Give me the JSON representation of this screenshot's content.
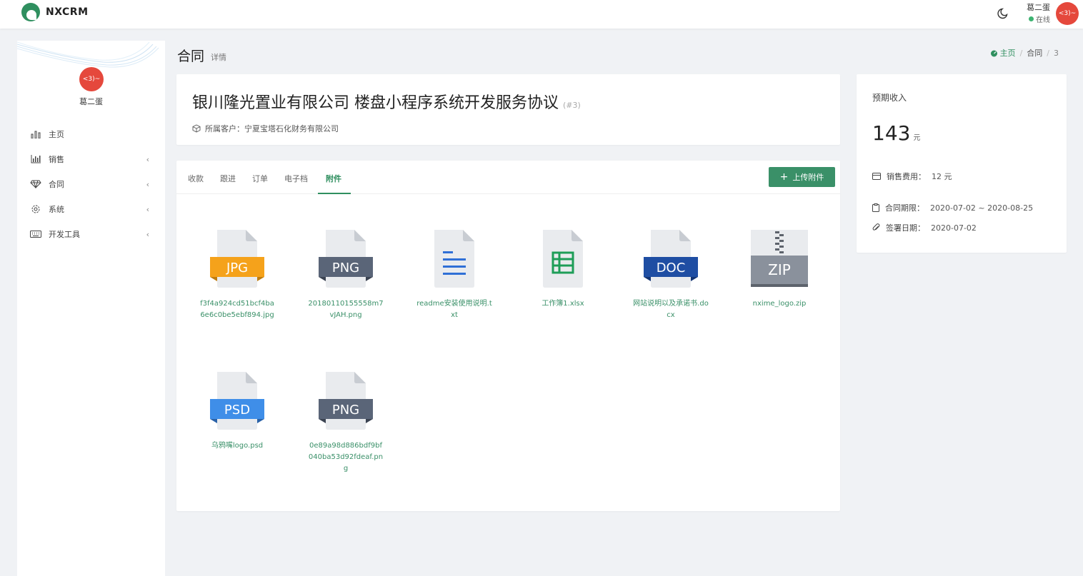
{
  "app": {
    "name": "NXCRM"
  },
  "topbar": {
    "user_name": "葛二蛋",
    "status": "在线",
    "avatar_text": "<3)~"
  },
  "sidebar": {
    "user_name": "葛二蛋",
    "avatar_text": "<3)~",
    "items": [
      {
        "label": "主页",
        "icon": "bar-chart-icon",
        "chevron": ""
      },
      {
        "label": "销售",
        "icon": "column-chart-icon",
        "chevron": "‹"
      },
      {
        "label": "合同",
        "icon": "diamond-icon",
        "chevron": "‹"
      },
      {
        "label": "系统",
        "icon": "gear-icon",
        "chevron": "‹"
      },
      {
        "label": "开发工具",
        "icon": "keyboard-icon",
        "chevron": "‹"
      }
    ]
  },
  "header": {
    "title": "合同",
    "subtitle": "详情"
  },
  "breadcrumb": {
    "home": "主页",
    "section": "合同",
    "current": "3"
  },
  "contract": {
    "title": "银川隆光置业有限公司 楼盘小程序系统开发服务协议",
    "id": "(#3)",
    "customer": "所属客户：宁夏宝塔石化财务有限公司"
  },
  "tabs": [
    "收款",
    "跟进",
    "订单",
    "电子档",
    "附件"
  ],
  "upload_label": "上传附件",
  "files": [
    {
      "badge": "JPG",
      "name": "f3f4a924cd51bcf4ba6e6c0be5ebf894.jpg",
      "color": "#f5a21b"
    },
    {
      "badge": "PNG",
      "name": "20180110155558m7vJAH.png",
      "color": "#5a6578"
    },
    {
      "badge": "",
      "name": "readme安装使用说明.txt",
      "color": "#2f6fd6"
    },
    {
      "badge": "",
      "name": "工作簿1.xlsx",
      "color": "#1e9e58"
    },
    {
      "badge": "DOC",
      "name": "网站说明以及承诺书.docx",
      "color": "#1f4ea3"
    },
    {
      "badge": "ZIP",
      "name": "nxime_logo.zip",
      "color": "#8a919c"
    },
    {
      "badge": "PSD",
      "name": "乌鸦嘴logo.psd",
      "color": "#3f8ee8"
    },
    {
      "badge": "PNG",
      "name": "0e89a98d886bdf9bf040ba53d92fdeaf.png",
      "color": "#5a6578"
    }
  ],
  "income": {
    "title": "预期收入",
    "value": "143",
    "unit": "元",
    "rows": [
      {
        "label": "销售费用：",
        "value": "12 元"
      },
      {
        "label": "合同期限：",
        "value": "2020-07-02 ~ 2020-08-25"
      },
      {
        "label": "签署日期：",
        "value": "2020-07-02"
      }
    ]
  }
}
